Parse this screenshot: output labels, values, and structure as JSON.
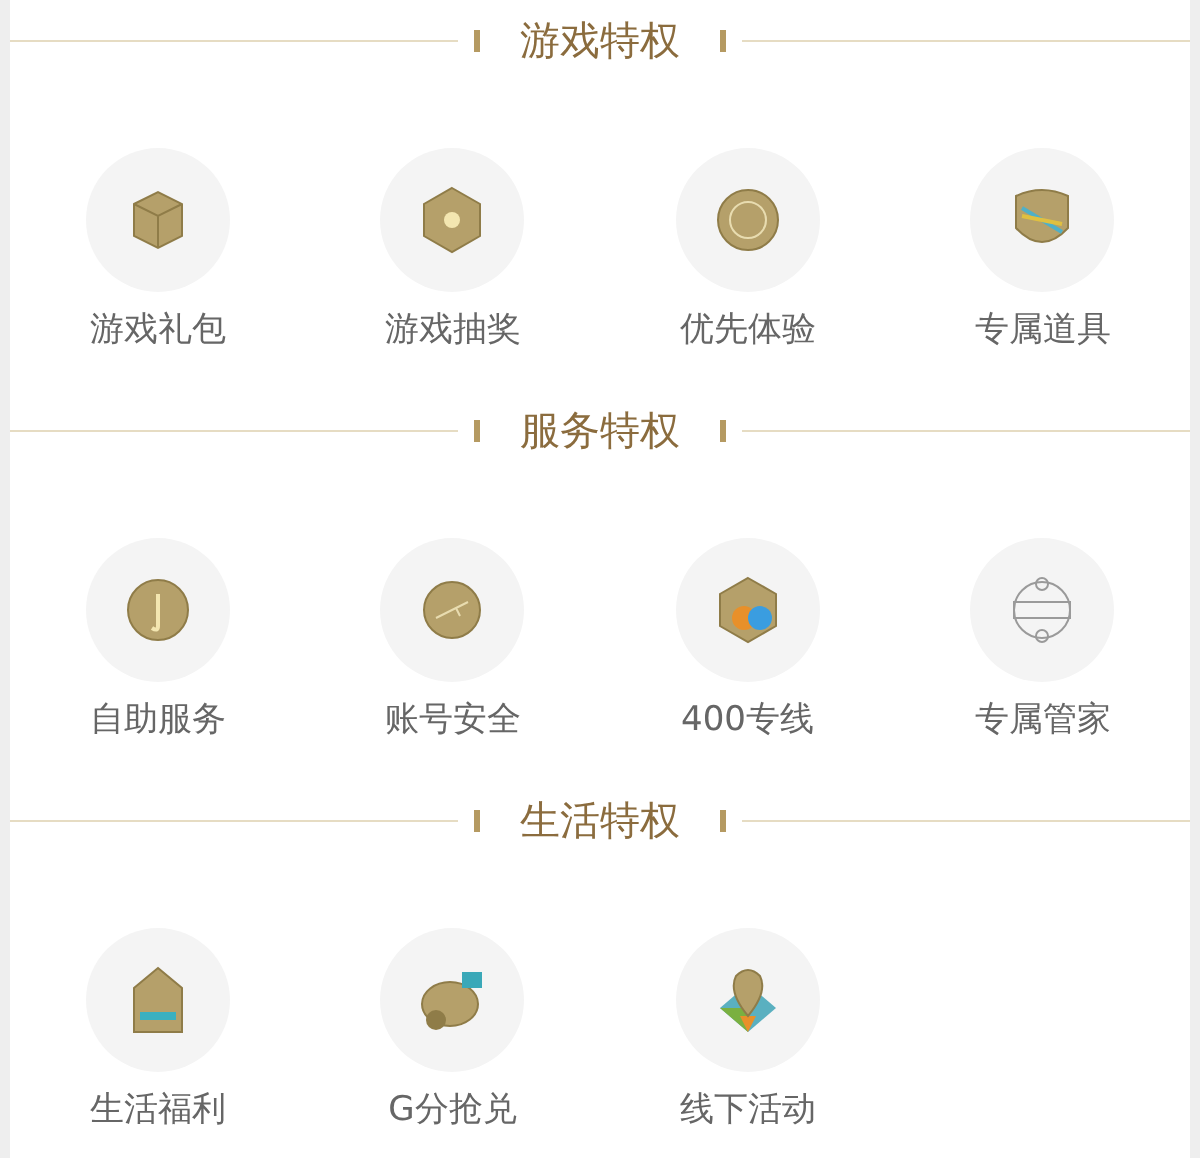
{
  "sections": [
    {
      "title": "游戏特权",
      "items": [
        {
          "label": "游戏礼包"
        },
        {
          "label": "游戏抽奖"
        },
        {
          "label": "优先体验"
        },
        {
          "label": "专属道具"
        }
      ]
    },
    {
      "title": "服务特权",
      "items": [
        {
          "label": "自助服务"
        },
        {
          "label": "账号安全"
        },
        {
          "label": "400专线"
        },
        {
          "label": "专属管家"
        }
      ]
    },
    {
      "title": "生活特权",
      "items": [
        {
          "label": "生活福利"
        },
        {
          "label": "G分抢兑"
        },
        {
          "label": "线下活动"
        }
      ]
    }
  ]
}
